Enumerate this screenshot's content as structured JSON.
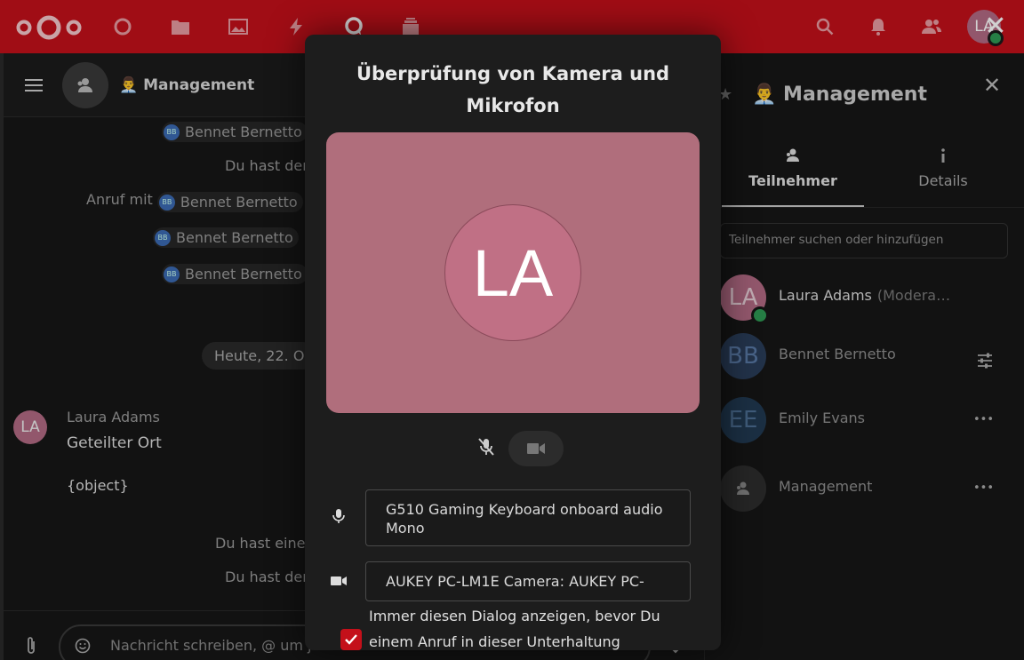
{
  "header": {
    "apps": [
      "dashboard-icon",
      "files-icon",
      "photos-icon",
      "activity-icon",
      "talk-icon",
      "deck-icon"
    ],
    "actions": [
      "search-icon",
      "notifications-icon",
      "contacts-icon"
    ],
    "user_initials": "LA",
    "close_symbol": "✕",
    "brand_color": "#c4101a"
  },
  "conversation": {
    "title": "👨‍💼 Management",
    "system_messages": [
      {
        "name": "Bennet Bernetto",
        "initials": "BB"
      },
      {
        "text": "Du hast der"
      },
      {
        "prefix": "Anruf mit",
        "name": "Bennet Bernetto",
        "initials": "BB"
      },
      {
        "name": "Bennet Bernetto",
        "initials": "BB"
      },
      {
        "name": "Bennet Bernetto",
        "initials": "BB"
      }
    ],
    "date_separator": "Heute, 22. O",
    "message": {
      "author_initials": "LA",
      "author": "Laura Adams",
      "text": "Geteilter Ort",
      "object": "{object}"
    },
    "later_messages": [
      "Du hast eine",
      "Du hast der"
    ],
    "composer_placeholder": "Nachricht schreiben, @ um jemanden zu erwähnen …"
  },
  "sidebar": {
    "title": "👨‍💼 Management",
    "close_symbol": "✕",
    "star_symbol": "★",
    "tabs": [
      {
        "label": "Teilnehmer",
        "icon": "participants-icon",
        "active": true
      },
      {
        "label": "Details",
        "icon": "info-icon",
        "active": false
      }
    ],
    "search_placeholder": "Teilnehmer suchen oder hinzufügen",
    "participants": [
      {
        "initials": "LA",
        "name": "Laura Adams",
        "suffix": "(Modera…",
        "online": true,
        "action": "",
        "color": "#b36b84",
        "text_color": "#dcdcdc"
      },
      {
        "initials": "BB",
        "name": "Bennet Bernetto",
        "suffix": "",
        "online": false,
        "action": "settings-sliders-icon",
        "color": "#2a3d5a",
        "text_color": "#8f8f8f"
      },
      {
        "initials": "EE",
        "name": "Emily Evans",
        "suffix": "",
        "online": false,
        "action": "more-icon",
        "color": "#223a52",
        "text_color": "#8f8f8f"
      },
      {
        "initials": "",
        "name": "Management",
        "suffix": "",
        "online": false,
        "action": "more-icon",
        "color": "#2e2e2e",
        "text_color": "#8f8f8f"
      }
    ],
    "more_symbol": "•••"
  },
  "modal": {
    "title": "Überprüfung von Kamera und Mikrofon",
    "preview_initials": "LA",
    "preview_color": "#b06e7c",
    "microphone_device": "G510 Gaming Keyboard onboard audio Mono",
    "camera_device": "AUKEY PC-LM1E Camera: AUKEY PC-",
    "checkbox_label": "Immer diesen Dialog anzeigen, bevor Du einem Anruf in dieser Unterhaltung",
    "checkbox_checked": true
  }
}
